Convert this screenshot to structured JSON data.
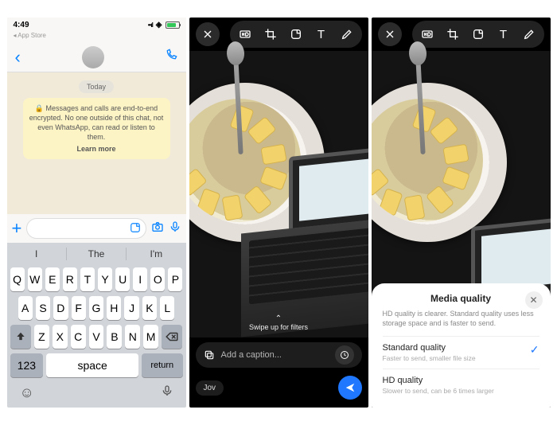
{
  "status_bar": {
    "time": "4:49",
    "am_icon": "⎘",
    "apple_back": "◂ App Store",
    "battery": "80"
  },
  "chat_header": {},
  "chat": {
    "today": "Today",
    "encryption": "🔒 Messages and calls are end-to-end encrypted. No one outside of this chat, not even WhatsApp, can read or listen to them.",
    "learn_more": "Learn more"
  },
  "keyboard": {
    "suggestions": [
      "I",
      "The",
      "I'm"
    ],
    "row1": [
      "Q",
      "W",
      "E",
      "R",
      "T",
      "Y",
      "U",
      "I",
      "O",
      "P"
    ],
    "row2": [
      "A",
      "S",
      "D",
      "F",
      "G",
      "H",
      "J",
      "K",
      "L"
    ],
    "row3": [
      "Z",
      "X",
      "C",
      "V",
      "B",
      "N",
      "M"
    ],
    "k123": "123",
    "space": "space",
    "return": "return"
  },
  "editor": {
    "swipe": "Swipe up for filters",
    "caption_placeholder": "Add a caption...",
    "recipient": "Jov"
  },
  "sheet": {
    "title": "Media quality",
    "description": "HD quality is clearer. Standard quality uses less storage space and is faster to send.",
    "options": [
      {
        "title": "Standard quality",
        "sub": "Faster to send, smaller file size",
        "selected": true
      },
      {
        "title": "HD quality",
        "sub": "Slower to send, can be 6 times larger",
        "selected": false
      }
    ]
  }
}
